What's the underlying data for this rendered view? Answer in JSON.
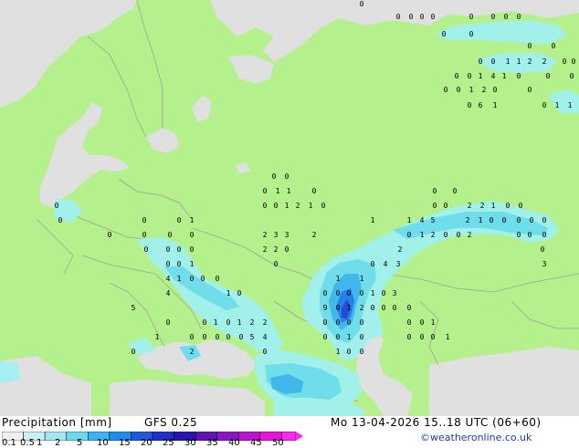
{
  "map": {
    "land_color": "#b4f08c",
    "sea_color": "#e0e0e0",
    "border_color": "#a0a0a0",
    "precip_colors": [
      "#a0f0f0",
      "#6cdcf0",
      "#3cb4f0",
      "#1e78f0",
      "#1a46d2",
      "#1414a0"
    ],
    "point_values": [
      "0",
      "0",
      "0",
      "0",
      "0",
      "0",
      "0",
      "0",
      "0",
      "0",
      "0",
      "0",
      "0",
      "0",
      "0",
      "1",
      "1",
      "2",
      "2",
      "0",
      "0",
      "0",
      "0",
      "1",
      "4",
      "1",
      "0",
      "0",
      "0",
      "0",
      "0",
      "1",
      "2",
      "0",
      "0",
      "0",
      "6",
      "1",
      "0",
      "1",
      "1",
      "0",
      "0",
      "0",
      "1",
      "1",
      "0",
      "0",
      "0",
      "1",
      "2",
      "1",
      "0",
      "0",
      "0",
      "0",
      "0",
      "2",
      "2",
      "1",
      "0",
      "0",
      "0",
      "0",
      "0",
      "1",
      "1",
      "1",
      "4",
      "5",
      "2",
      "1",
      "0",
      "0",
      "0",
      "0",
      "0",
      "0",
      "0",
      "0",
      "0",
      "0",
      "2",
      "3",
      "3",
      "2",
      "0",
      "1",
      "2",
      "0",
      "0",
      "2",
      "0",
      "0",
      "0",
      "0",
      "0",
      "0",
      "0",
      "2",
      "2",
      "0",
      "2",
      "0",
      "0",
      "0",
      "1",
      "0",
      "0",
      "4",
      "3",
      "3",
      "4",
      "1",
      "0",
      "0",
      "0",
      "1",
      "1",
      "4",
      "1",
      "0",
      "0",
      "0",
      "0",
      "0",
      "1",
      "0",
      "3",
      "5",
      "9",
      "0",
      "1",
      "2",
      "0",
      "0",
      "0",
      "0",
      "0",
      "0",
      "1",
      "0",
      "1",
      "2",
      "2",
      "0",
      "0",
      "0",
      "0",
      "0",
      "0",
      "1",
      "1",
      "0",
      "0",
      "0",
      "0",
      "0",
      "5",
      "4",
      "0",
      "0",
      "1",
      "0",
      "0",
      "0",
      "0",
      "1",
      "0",
      "2",
      "0",
      "1",
      "0",
      "0"
    ]
  },
  "footer": {
    "title": "Precipitation [mm]",
    "model": "GFS 0.25",
    "datetime": "Mo 13-04-2026 15..18 UTC (06+60)",
    "credit": "©weatheronline.co.uk",
    "scale_labels": [
      "0.1",
      "0.5",
      "1",
      "2",
      "5",
      "10",
      "15",
      "20",
      "25",
      "30",
      "35",
      "40",
      "45",
      "50"
    ],
    "scale_colors": [
      "#f0f0f0",
      "#c8f0f0",
      "#a0e8f0",
      "#6cd8f0",
      "#3cb4f0",
      "#1e8cf0",
      "#1e5adc",
      "#1a32c8",
      "#2814b4",
      "#5a14b4",
      "#8c14c8",
      "#be14d2",
      "#e614dc",
      "#ff28f0"
    ]
  }
}
